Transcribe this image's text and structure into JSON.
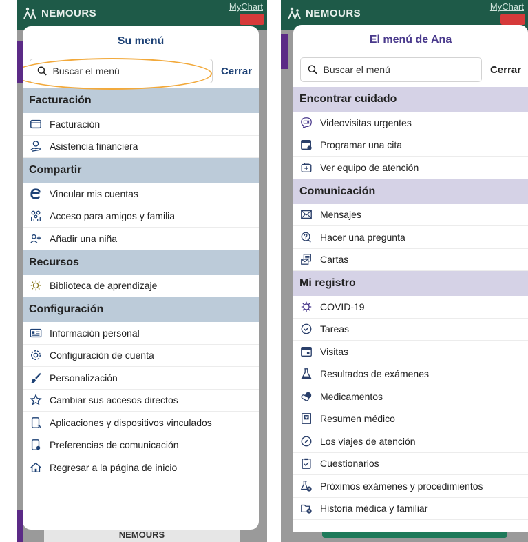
{
  "left": {
    "brand": "NEMOURS",
    "mychart": "MyChart",
    "title": "Su menú",
    "search_placeholder": "Buscar el menú",
    "close_label": "Cerrar",
    "bottom_peek": "NEMOURS",
    "sections": [
      {
        "header": "Facturación",
        "items": [
          {
            "label": "Facturación",
            "icon": "credit-card-icon"
          },
          {
            "label": "Asistencia financiera",
            "icon": "hand-coin-icon"
          }
        ]
      },
      {
        "header": "Compartir",
        "items": [
          {
            "label": "Vincular mis cuentas",
            "icon": "e-link-icon"
          },
          {
            "label": "Acceso para amigos y familia",
            "icon": "family-icon"
          },
          {
            "label": "Añadir una niña",
            "icon": "add-person-icon"
          }
        ]
      },
      {
        "header": "Recursos",
        "items": [
          {
            "label": "Biblioteca de aprendizaje",
            "icon": "lightbulb-icon"
          }
        ]
      },
      {
        "header": "Configuración",
        "items": [
          {
            "label": "Información personal",
            "icon": "id-card-icon"
          },
          {
            "label": "Configuración de cuenta",
            "icon": "gear-icon"
          },
          {
            "label": "Personalización",
            "icon": "paintbrush-icon"
          },
          {
            "label": "Cambiar sus accesos directos",
            "icon": "star-icon"
          },
          {
            "label": "Aplicaciones y dispositivos vinculados",
            "icon": "phone-link-icon"
          },
          {
            "label": "Preferencias de comunicación",
            "icon": "phone-gear-icon"
          },
          {
            "label": "Regresar a la página de inicio",
            "icon": "home-icon"
          }
        ]
      }
    ]
  },
  "right": {
    "brand": "NEMOURS",
    "mychart": "MyChart",
    "title": "El menú de Ana",
    "search_placeholder": "Buscar el menú",
    "close_label": "Cerrar",
    "sections": [
      {
        "header": "Encontrar cuidado",
        "items": [
          {
            "label": "Videovisitas urgentes",
            "icon": "video-chat-icon"
          },
          {
            "label": "Programar una cita",
            "icon": "calendar-add-icon"
          },
          {
            "label": "Ver equipo de atención",
            "icon": "medical-bag-icon"
          }
        ]
      },
      {
        "header": "Comunicación",
        "items": [
          {
            "label": "Mensajes",
            "icon": "envelope-icon"
          },
          {
            "label": "Hacer una pregunta",
            "icon": "question-bubble-icon"
          },
          {
            "label": "Cartas",
            "icon": "letter-icon"
          }
        ]
      },
      {
        "header": "Mi registro",
        "items": [
          {
            "label": "COVID-19",
            "icon": "virus-icon"
          },
          {
            "label": "Tareas",
            "icon": "check-clock-icon"
          },
          {
            "label": "Visitas",
            "icon": "calendar-icon"
          },
          {
            "label": "Resultados de exámenes",
            "icon": "flask-icon"
          },
          {
            "label": "Medicamentos",
            "icon": "pill-icon"
          },
          {
            "label": "Resumen médico",
            "icon": "heart-document-icon"
          },
          {
            "label": "Los viajes de atención",
            "icon": "compass-icon"
          },
          {
            "label": "Cuestionarios",
            "icon": "checklist-icon"
          },
          {
            "label": "Próximos exámenes y procedimientos",
            "icon": "flask-clock-icon"
          },
          {
            "label": "Historia médica y familiar",
            "icon": "folder-clock-icon"
          }
        ]
      }
    ]
  }
}
